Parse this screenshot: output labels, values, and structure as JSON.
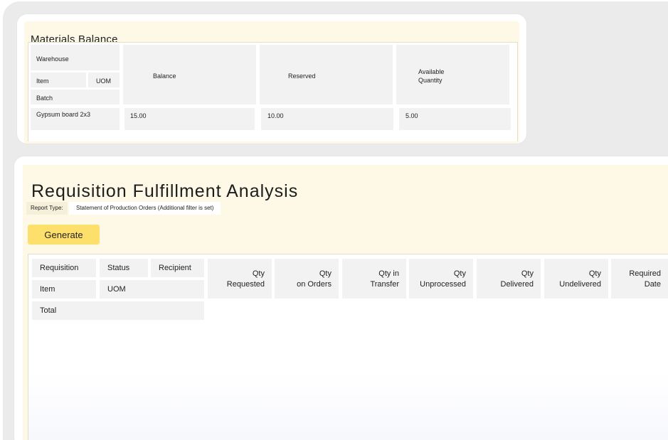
{
  "materials_balance": {
    "title": "Materials Balance",
    "headers": {
      "warehouse": "Warehouse",
      "item": "Item",
      "uom": "UOM",
      "batch": "Batch",
      "balance": "Balance",
      "reserved": "Reserved",
      "available_line1": "Available",
      "available_line2": "Quantity"
    },
    "row": {
      "name": "Gypsum board 2x3",
      "balance": "15.00",
      "reserved": "10.00",
      "available": "5.00"
    }
  },
  "requisition": {
    "title": "Requisition Fulfillment Analysis",
    "report_type_label": "Report Type:",
    "report_type_value": "Statement of Production Orders (Additional filter is set)",
    "generate_label": "Generate",
    "headers": {
      "requisition": "Requisition",
      "status": "Status",
      "recipient": "Recipient",
      "item": "Item",
      "uom": "UOM",
      "total": "Total",
      "columns": [
        {
          "line1": "Qty",
          "line2": "Requested"
        },
        {
          "line1": "Qty",
          "line2": "on Orders"
        },
        {
          "line1": "Qty in",
          "line2": "Transfer"
        },
        {
          "line1": "Qty",
          "line2": "Unprocessed"
        },
        {
          "line1": "Qty",
          "line2": "Delivered"
        },
        {
          "line1": "Qty",
          "line2": "Undelivered"
        },
        {
          "line1": "Required",
          "line2": "Date"
        }
      ]
    }
  },
  "colors": {
    "backdrop": "#ebebeb",
    "panel_cream": "#fdf9e6",
    "cell_gray": "#f2f2f2",
    "button_yellow": "#fde06b"
  }
}
